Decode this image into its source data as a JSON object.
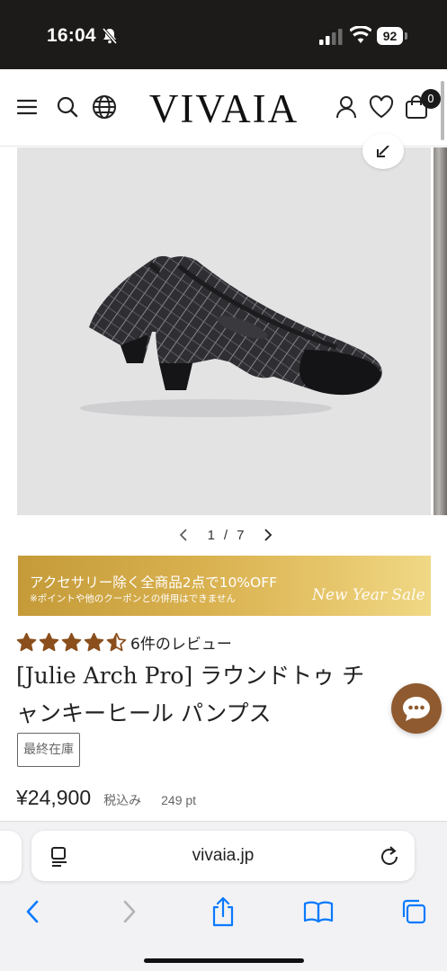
{
  "status_bar": {
    "time": "16:04",
    "battery": "92",
    "icons": [
      "bell-slash-icon",
      "signal-icon",
      "wifi-icon",
      "battery-icon"
    ]
  },
  "header": {
    "logo": "VIVAIA",
    "cart_count": "0",
    "icons": [
      "menu-icon",
      "search-icon",
      "globe-icon",
      "account-icon",
      "heart-icon",
      "cart-icon"
    ]
  },
  "gallery": {
    "current": "1",
    "separator": "/",
    "total": "7",
    "background": "#e3e3e4"
  },
  "promo_banner": {
    "title": "アクセサリー除く全商品2点で10%OFF",
    "subtitle": "※ポイントや他のクーポンとの併用はできません",
    "script_text": "New Year Sale"
  },
  "product": {
    "rating": 4.5,
    "rating_max": 5,
    "review_text": "6件のレビュー",
    "title_line1": "[Julie Arch Pro] ラウンドトゥ チ",
    "title_line2": "ャンキーヒール パンプス",
    "stock_badge": "最終在庫",
    "price": "¥24,900",
    "tax_label": "税込み",
    "points": "249 pt"
  },
  "safari": {
    "url": "vivaia.jp",
    "toolbar_icons": [
      "back-icon",
      "forward-icon",
      "share-icon",
      "bookmarks-icon",
      "tabs-icon"
    ]
  },
  "colors": {
    "star": "#8a4f1c",
    "chat": "#8f5a2f",
    "banner_gold": "#d9b14f",
    "ios_blue": "#0a7aff"
  }
}
